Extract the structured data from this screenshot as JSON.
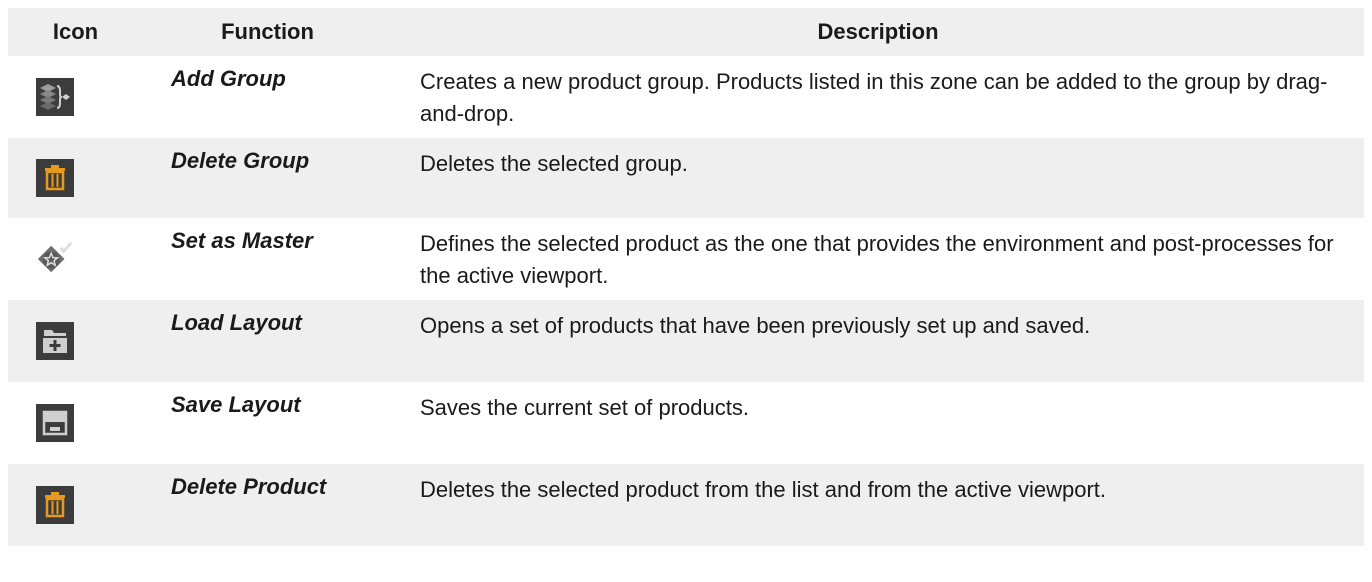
{
  "header": {
    "icon": "Icon",
    "function": "Function",
    "description": "Description"
  },
  "rows": [
    {
      "icon": "add-group-icon",
      "function": "Add Group",
      "description": "Creates a new product group. Products listed in this zone can be added to the group by drag-and-drop."
    },
    {
      "icon": "trash-icon",
      "function": "Delete Group",
      "description": "Deletes the selected group."
    },
    {
      "icon": "star-check-icon",
      "function": "Set as Master",
      "description": "Defines the selected product as the one that provides the environment and post-processes for the active viewport."
    },
    {
      "icon": "folder-add-icon",
      "function": "Load Layout",
      "description": "Opens a set of products that have been previously set up and saved."
    },
    {
      "icon": "floppy-disk-icon",
      "function": "Save Layout",
      "description": "Saves the current set of products."
    },
    {
      "icon": "trash-icon",
      "function": "Delete Product",
      "description": "Deletes the selected product from the list and from the active viewport."
    }
  ],
  "colors": {
    "icon_bg": "#3c3c3c",
    "trash_accent": "#e89a1e",
    "icon_gray": "#bdbdbd",
    "row_shade": "#efefef"
  }
}
